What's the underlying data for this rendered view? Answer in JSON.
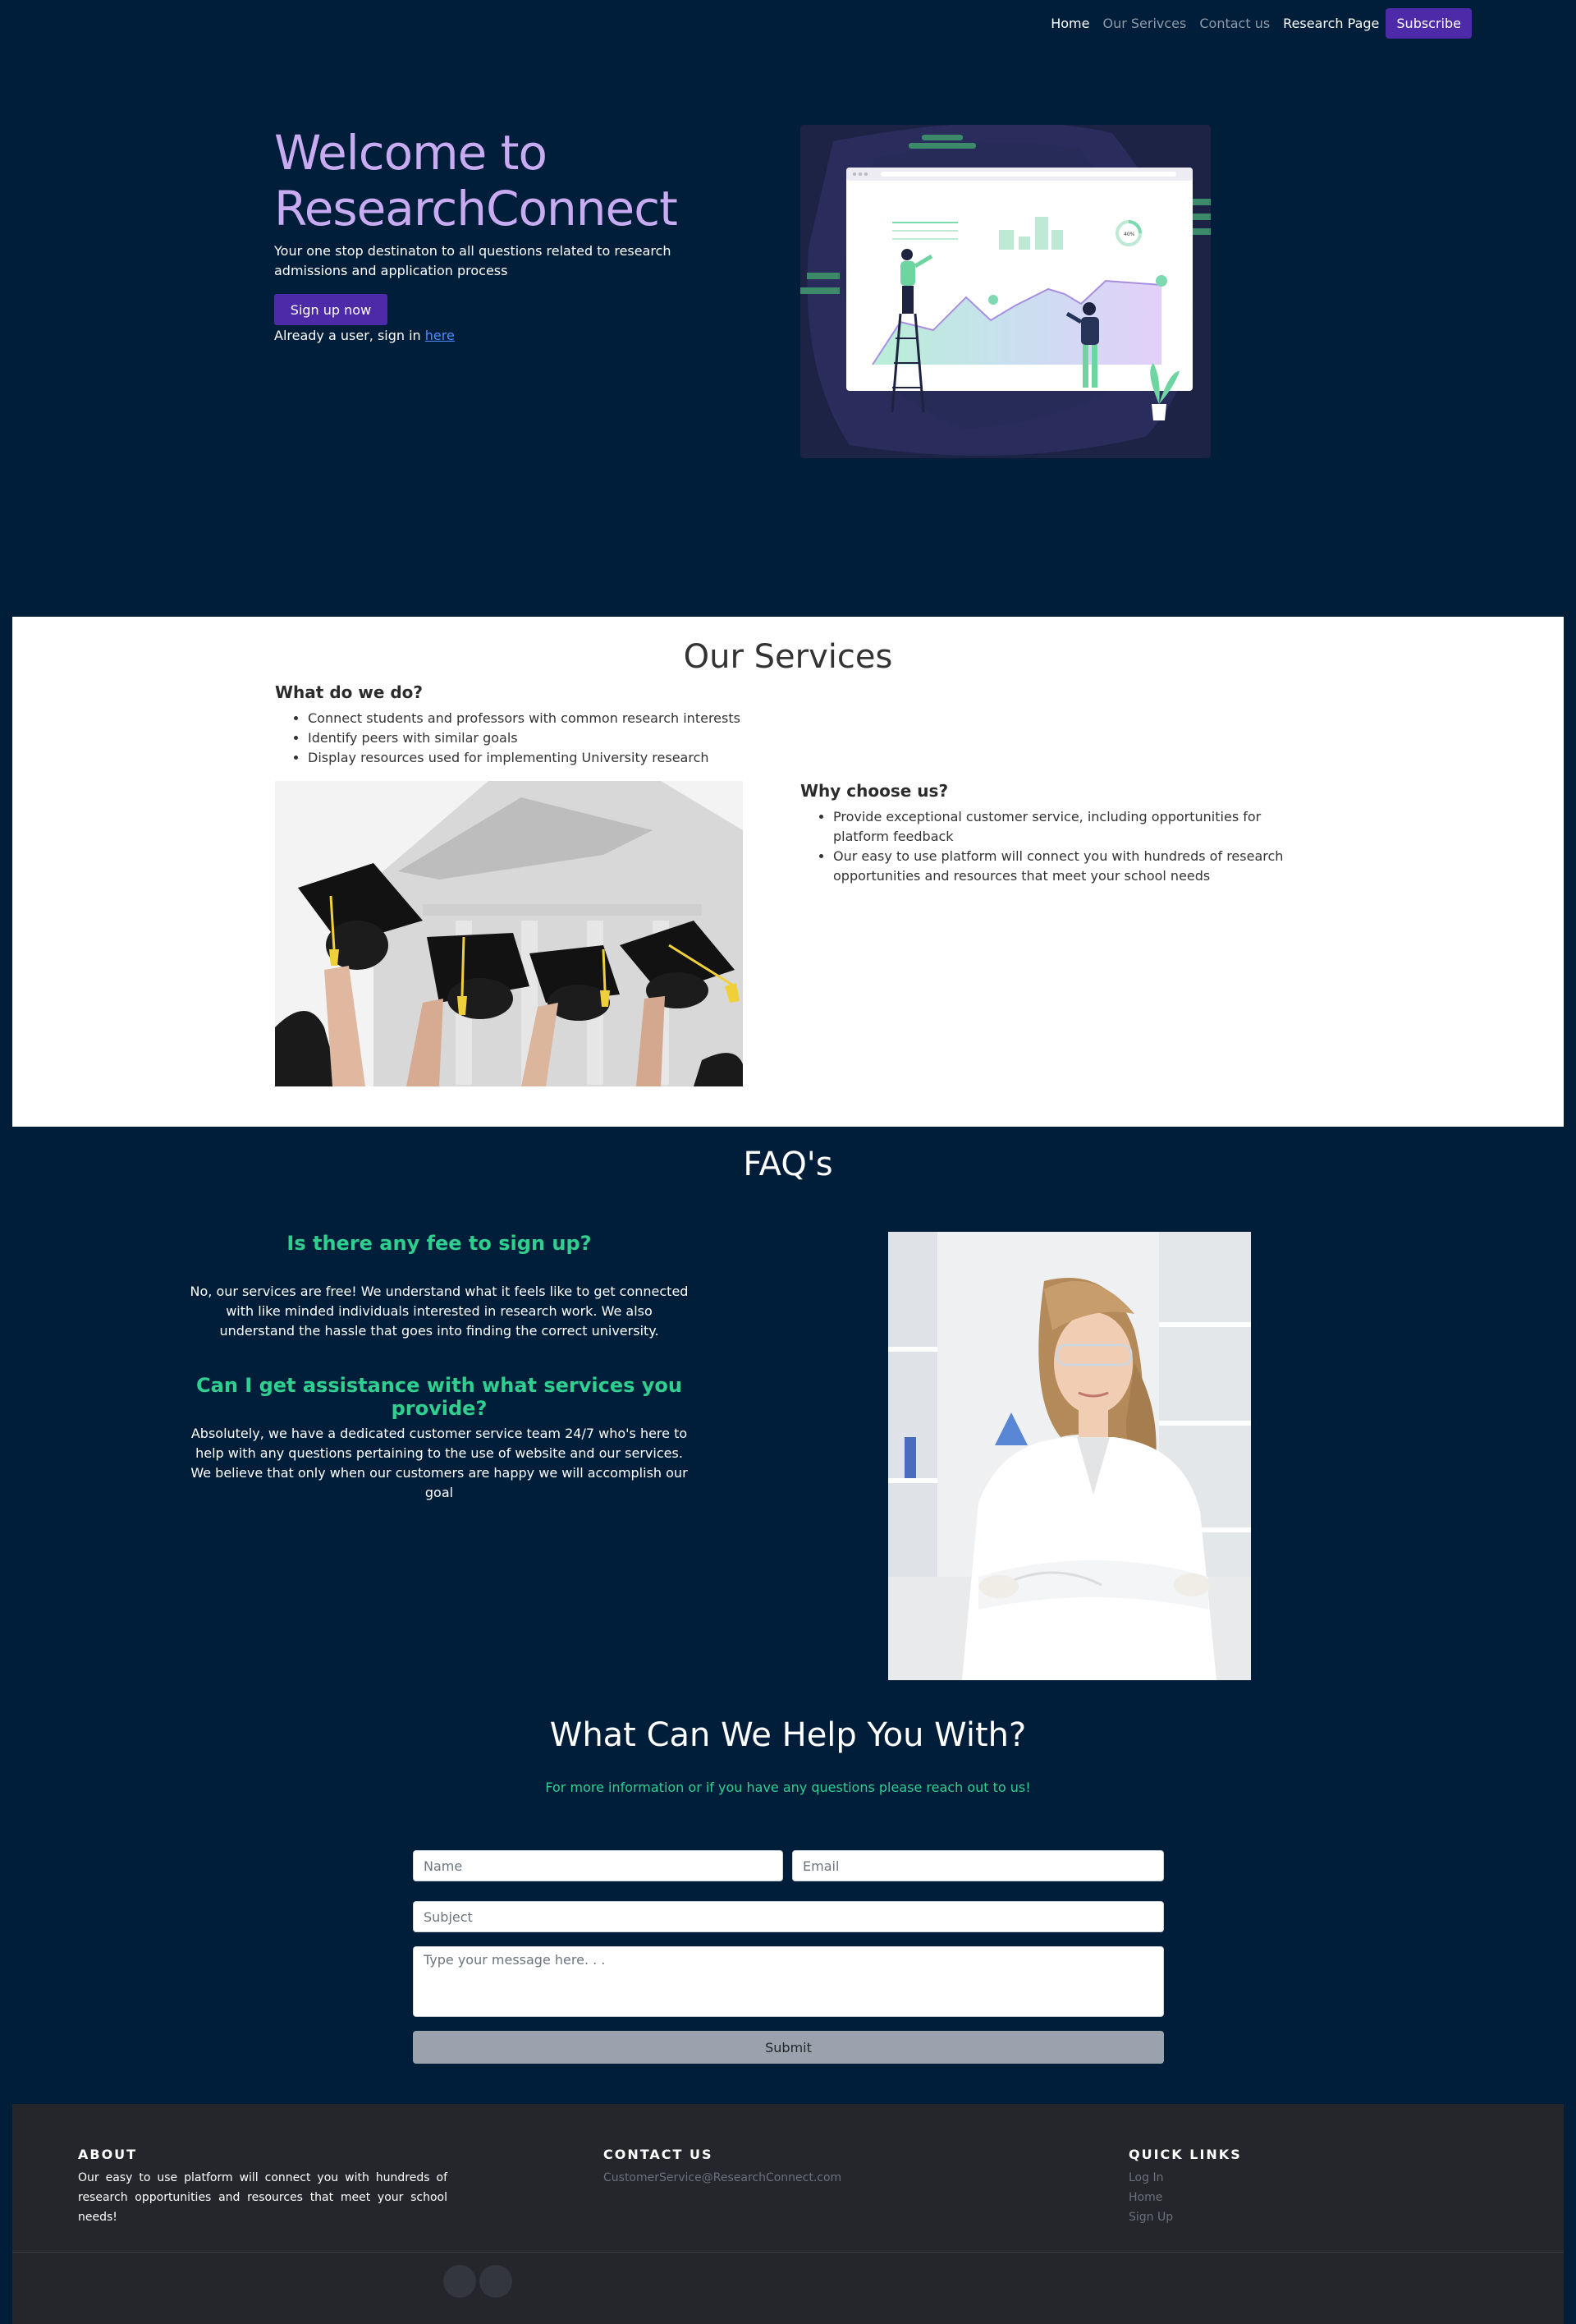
{
  "nav": {
    "items": [
      "Home",
      "Our Serivces",
      "Contact us",
      "Research Page"
    ],
    "subscribe": "Subscribe"
  },
  "hero": {
    "title": "Welcome to ResearchConnect",
    "subtitle": "Your one stop destinaton to all questions related to research admissions and application process",
    "signup": "Sign up now",
    "already_prefix": "Already a user, sign in ",
    "here": "here"
  },
  "services": {
    "title": "Our Services",
    "what_title": "What do we do?",
    "what_items": [
      "Connect students and professors with common research interests",
      "Identify peers with similar goals",
      "Display resources used for implementing University research"
    ],
    "why_title": "Why choose us?",
    "why_items": [
      "Provide exceptional customer service, including opportunities for platform feedback",
      "Our easy to use platform will connect you with hundreds of research opportunities and resources that meet your school needs"
    ]
  },
  "faq": {
    "title": "FAQ's",
    "items": [
      {
        "q": "Is there any fee to sign up?",
        "a": "No, our services are free! We understand what it feels like to get connected with like minded individuals interested in research work. We also understand the hassle that goes into finding the correct university."
      },
      {
        "q": "Can I get assistance with what services you provide?",
        "a": "Absolutely, we have a dedicated customer service team 24/7 who's here to help with any questions pertaining to the use of website and our services. We believe that only when our customers are happy we will accomplish our goal"
      }
    ]
  },
  "contact": {
    "title": "What Can We Help You With?",
    "subtitle": "For more information or if you have any questions please reach out to us!",
    "name_placeholder": "Name",
    "email_placeholder": "Email",
    "subject_placeholder": "Subject",
    "message_placeholder": "Type your message here. . .",
    "submit": "Submit"
  },
  "footer": {
    "about_title": "ABOUT",
    "about_text": "Our easy to use platform will connect you with hundreds of research opportunities and resources that meet your school needs!",
    "contact_title": "CONTACT US",
    "contact_email": "CustomerService@ResearchConnect.com",
    "links_title": "QUICK LINKS",
    "links": [
      "Log In",
      "Home",
      "Sign Up"
    ]
  },
  "colors": {
    "page_bg": "#001e3a",
    "accent_purple": "#4c2aa8",
    "hero_title": "#c9abf2",
    "faq_green": "#2fcf90",
    "footer_bg": "#25262b"
  }
}
